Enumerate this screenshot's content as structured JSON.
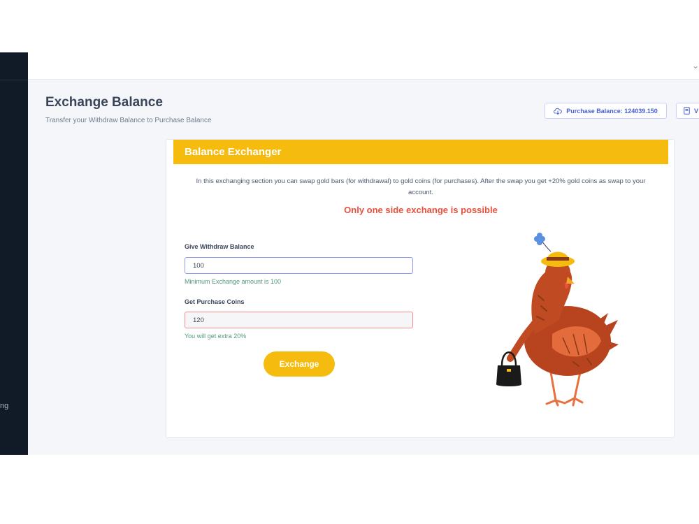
{
  "sidebar": {
    "fragment_text": "ng"
  },
  "topbar": {
    "caret_icon": "chevron-down-icon"
  },
  "header": {
    "title": "Exchange Balance",
    "subtitle": "Transfer your Withdraw Balance to Purchase Balance",
    "purchase_balance_label": "Purchase Balance: 124039.150",
    "second_button_label": "V"
  },
  "card": {
    "title": "Balance Exchanger",
    "intro": "In this exchanging section you can swap gold bars (for withdrawal) to gold coins (for purchases). After the swap you get +20% gold coins as swap to your account.",
    "warning": "Only one side exchange is possible"
  },
  "form": {
    "withdraw_label": "Give Withdraw Balance",
    "withdraw_value": "100",
    "withdraw_hint": "Minimum Exchange amount is 100",
    "purchase_label": "Get Purchase Coins",
    "purchase_value": "120",
    "purchase_hint": "You will get extra 20%",
    "submit_label": "Exchange"
  },
  "colors": {
    "accent": "#f5bc0f",
    "warning": "#e8503b",
    "link": "#4a5fd6",
    "hint": "#52987b",
    "sidebar": "#111b27"
  }
}
